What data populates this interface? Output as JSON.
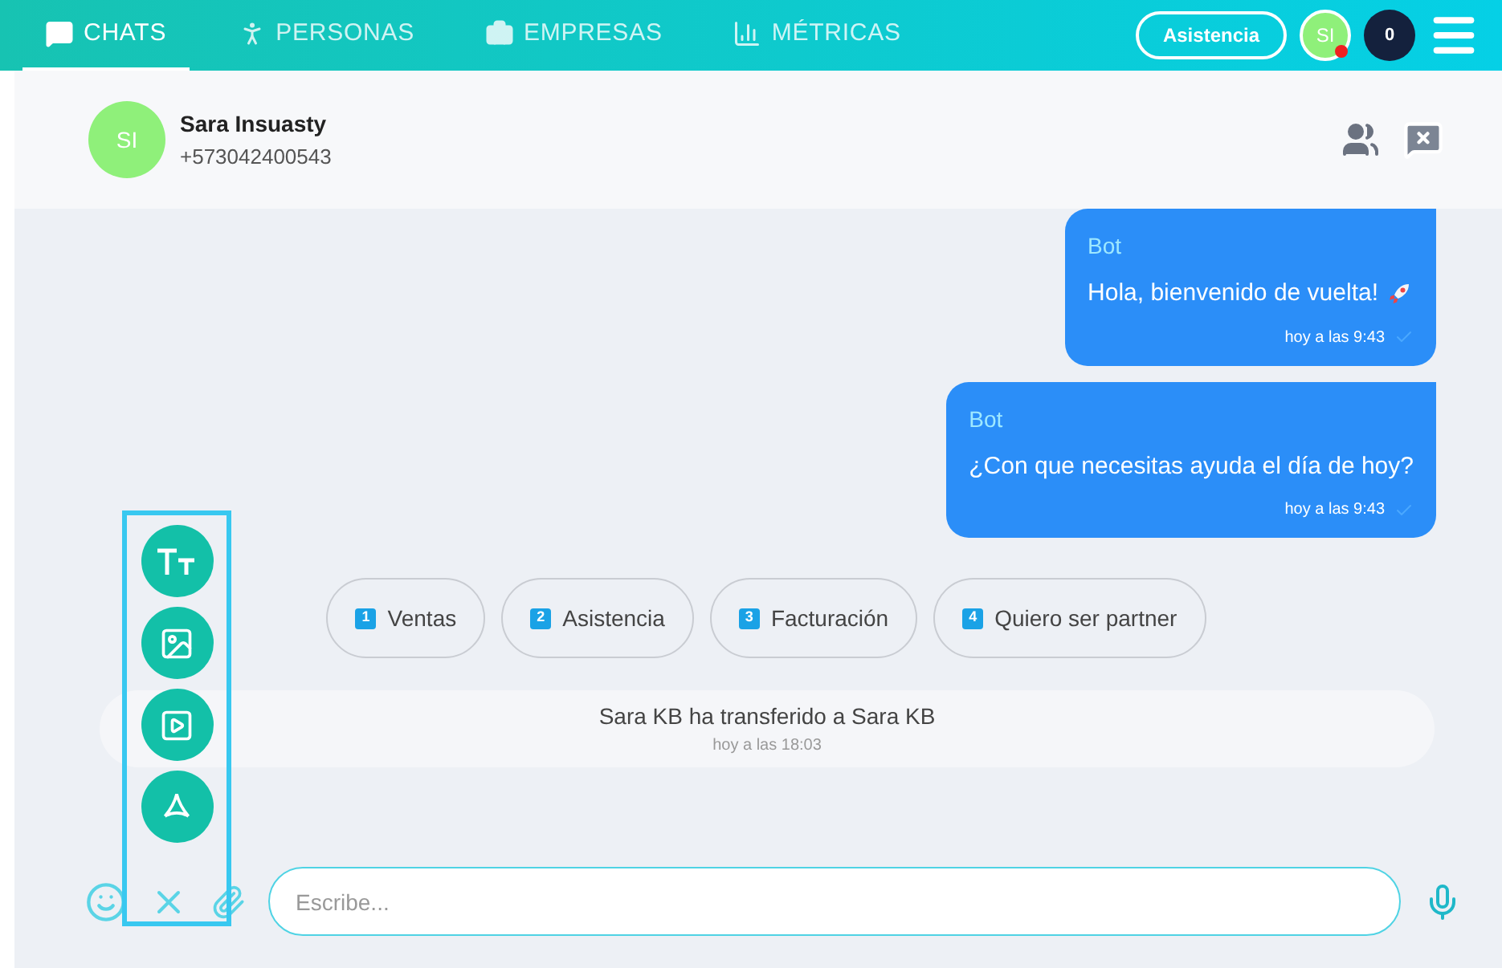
{
  "nav": {
    "tabs": [
      {
        "label": "CHATS",
        "kind": "chat",
        "selected": true
      },
      {
        "label": "PERSONAS",
        "kind": "person",
        "selected": false
      },
      {
        "label": "EMPRESAS",
        "kind": "briefcase",
        "selected": false
      },
      {
        "label": "MÉTRICAS",
        "kind": "chart",
        "selected": false
      }
    ],
    "assist_button": "Asistencia",
    "user_initials": "SI",
    "user_online": false,
    "counter": "0"
  },
  "contact": {
    "initials": "SI",
    "name": "Sara Insuasty",
    "phone": "+573042400543"
  },
  "messages": [
    {
      "sender": "Bot",
      "text": "Hola, bienvenido de vuelta!",
      "rocket": true,
      "time": "hoy a las 9:43"
    },
    {
      "sender": "Bot",
      "text": "¿Con que necesitas ayuda el día de hoy?",
      "rocket": false,
      "time": "hoy a las 9:43"
    }
  ],
  "quick_replies": [
    {
      "number": "1",
      "label": "Ventas"
    },
    {
      "number": "2",
      "label": "Asistencia"
    },
    {
      "number": "3",
      "label": "Facturación"
    },
    {
      "number": "4",
      "label": "Quiero ser partner"
    }
  ],
  "system_message": {
    "text": "Sara KB ha transferido a Sara KB",
    "time": "hoy a las 18:03"
  },
  "attach_menu": {
    "open": true,
    "items": [
      {
        "kind": "text"
      },
      {
        "kind": "image"
      },
      {
        "kind": "video"
      },
      {
        "kind": "pdf"
      }
    ]
  },
  "composer": {
    "placeholder": "Escribe..."
  }
}
